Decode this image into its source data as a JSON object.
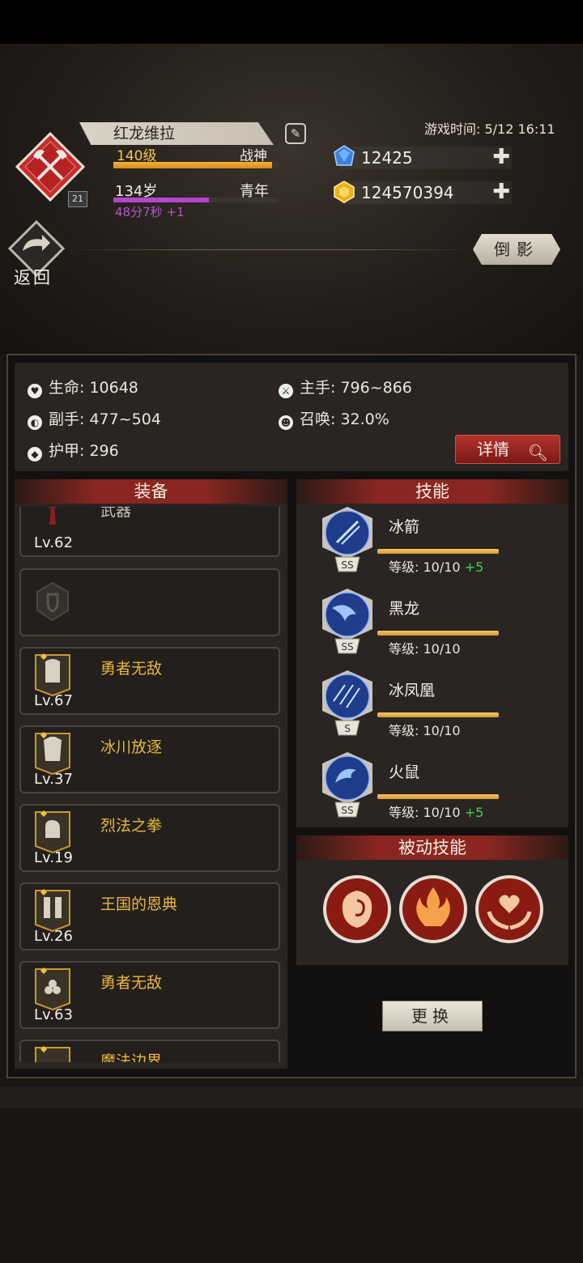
{
  "header": {
    "faint_text": "…2 1 1 8",
    "character_name": "红龙维拉",
    "level": "140级",
    "rank": "战神",
    "level_progress": 0.96,
    "age": "134岁",
    "life_stage": "青年",
    "age_progress": 0.58,
    "age_timer": "48分7秒 +1",
    "emblem_badge": "21",
    "game_time": "游戏时间: 5/12 16:11",
    "gems": "12425",
    "gold": "124570394",
    "back_label": "返回",
    "reflection_button": "倒影"
  },
  "stats": {
    "hp": "生命: 10648",
    "main_hand": "主手: 796~866",
    "off_hand": "副手: 477~504",
    "summon": "召唤: 32.0%",
    "armor": "护甲: 296",
    "details_button": "详情"
  },
  "equipment": {
    "title": "装备",
    "items": [
      {
        "name": "武器",
        "level": "Lv.62"
      },
      {
        "name": "",
        "level": ""
      },
      {
        "name": "勇者无敌",
        "level": "Lv.67"
      },
      {
        "name": "冰川放逐",
        "level": "Lv.37"
      },
      {
        "name": "烈法之拳",
        "level": "Lv.19"
      },
      {
        "name": "王国的恩典",
        "level": "Lv.26"
      },
      {
        "name": "勇者无敌",
        "level": "Lv.63"
      },
      {
        "name": "魔法边界",
        "level": ""
      }
    ]
  },
  "skills": {
    "title": "技能",
    "items": [
      {
        "name": "冰箭",
        "rank": "SS",
        "level": "等级: 10/10",
        "bonus": "+5"
      },
      {
        "name": "黑龙",
        "rank": "SS",
        "level": "等级: 10/10",
        "bonus": ""
      },
      {
        "name": "冰凤凰",
        "rank": "S",
        "level": "等级: 10/10",
        "bonus": ""
      },
      {
        "name": "火鼠",
        "rank": "SS",
        "level": "等级: 10/10",
        "bonus": "+5"
      }
    ]
  },
  "passive": {
    "title": "被动技能",
    "swap_button": "更换"
  },
  "colors": {
    "gold_text": "#e9b73f",
    "accent_red": "#8a2620",
    "bonus_green": "#3fd64a",
    "age_purple": "#b357cf"
  }
}
